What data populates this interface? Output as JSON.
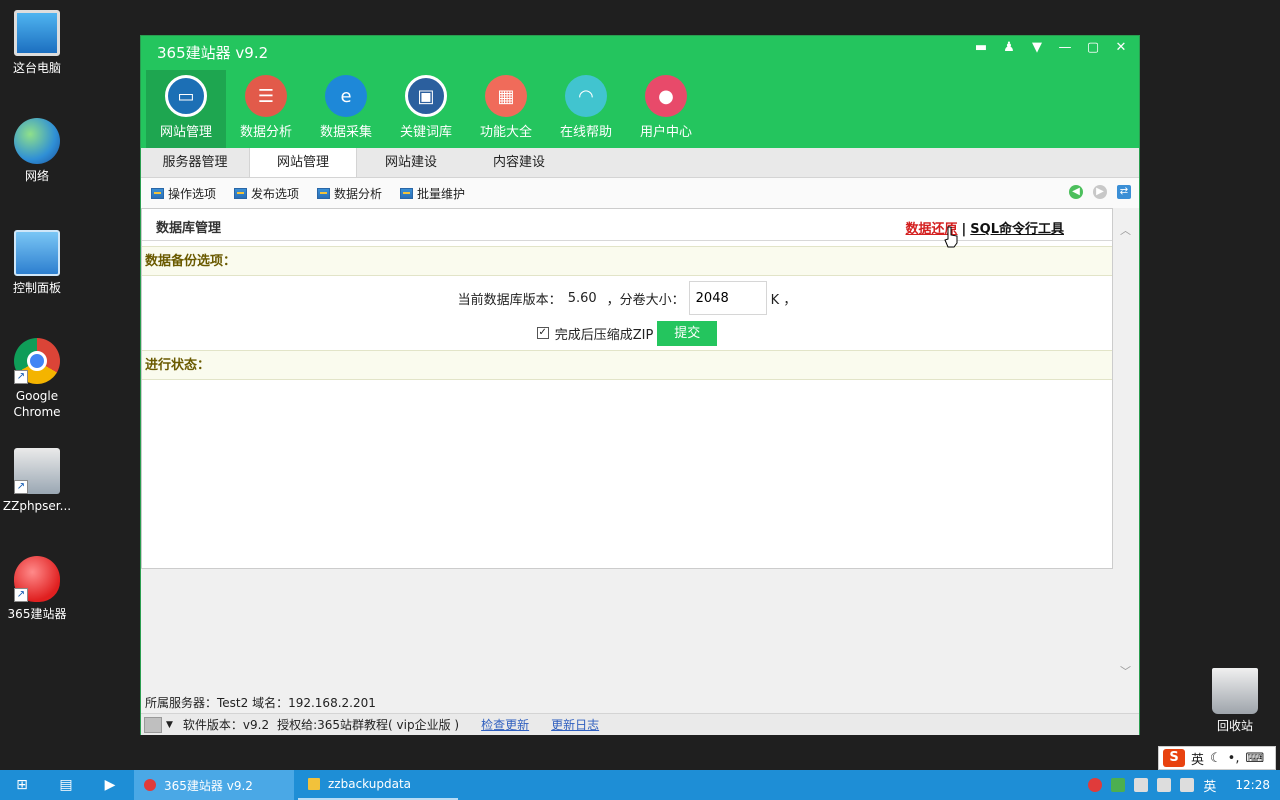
{
  "desktop": {
    "icons": [
      {
        "label": "这台电脑",
        "icon": "computer-icon"
      },
      {
        "label": "网络",
        "icon": "network-icon"
      },
      {
        "label": "控制面板",
        "icon": "control-panel-icon"
      },
      {
        "label": "Google Chrome",
        "icon": "chrome-icon"
      },
      {
        "label": "ZZphpser...",
        "icon": "zzphpserver-icon"
      },
      {
        "label": "365建站器",
        "icon": "apple-icon"
      },
      {
        "label": "回收站",
        "icon": "recycle-bin-icon"
      }
    ]
  },
  "app": {
    "title": "365建站器 v9.2",
    "window_controls": [
      "chat-icon",
      "shirt-icon",
      "menu-icon",
      "minimize-icon",
      "maximize-icon",
      "close-icon"
    ],
    "nav": [
      {
        "label": "网站管理",
        "icon": "monitor-icon",
        "color": "#1c6fb5"
      },
      {
        "label": "数据分析",
        "icon": "database-icon",
        "color": "#e25a4a"
      },
      {
        "label": "数据采集",
        "icon": "ie-icon",
        "color": "#1e88d8"
      },
      {
        "label": "关键词库",
        "icon": "book-icon",
        "color": "#2b5f9e"
      },
      {
        "label": "功能大全",
        "icon": "grid-icon",
        "color": "#f06b5a"
      },
      {
        "label": "在线帮助",
        "icon": "headset-icon",
        "color": "#41c4cf"
      },
      {
        "label": "用户中心",
        "icon": "user-icon",
        "color": "#e84a6a"
      }
    ],
    "tabs": [
      "服务器管理",
      "网站管理",
      "网站建设",
      "内容建设"
    ],
    "toolbar": [
      "操作选项",
      "发布选项",
      "数据分析",
      "批量维护"
    ],
    "content": {
      "header_title": "数据库管理",
      "link_restore": "数据还原",
      "link_sep": "|",
      "link_sql": "SQL命令行工具",
      "backup_section": "数据备份选项：",
      "db_version_label": "当前数据库版本：",
      "db_version": "5.60",
      "volume_label": "，分卷大小：",
      "volume_value": "2048",
      "volume_unit": "K ，",
      "zip_label": "完成后压缩成ZIP",
      "zip_checked": true,
      "submit_label": "提交",
      "status_section": "进行状态："
    },
    "server_info": "所属服务器：Test2 域名：192.168.2.201",
    "footer": {
      "version": "软件版本：v9.2",
      "license": "授权给:365站群教程( vip企业版 )",
      "check_update": "检查更新",
      "changelog": "更新日志"
    }
  },
  "taskbar": {
    "tasks": [
      "365建站器 v9.2",
      "zzbackupdata"
    ],
    "ime_lang": "英",
    "tray_lang": "英",
    "clock": "12:28"
  },
  "colors": {
    "accent_green": "#24c55e",
    "taskbar_blue": "#1e8ed6"
  }
}
